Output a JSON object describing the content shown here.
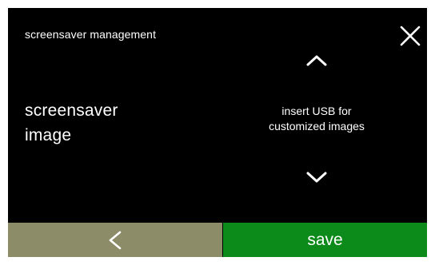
{
  "header": {
    "title": "screensaver management",
    "close_icon": "close-icon"
  },
  "setting": {
    "label": "screensaver\nimage",
    "value": "insert USB for\ncustomized images",
    "up_icon": "chevron-up-icon",
    "down_icon": "chevron-down-icon"
  },
  "footer": {
    "back_icon": "chevron-left-icon",
    "save_label": "save"
  },
  "colors": {
    "background": "#000000",
    "frame": "#ffffff",
    "text": "#ffffff",
    "back_button": "#8c8c68",
    "save_button": "#0c8a1a"
  }
}
